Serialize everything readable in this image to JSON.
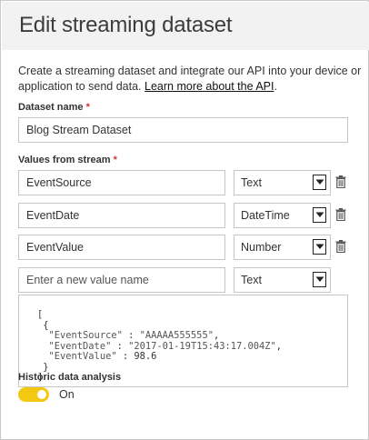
{
  "dialog": {
    "title": "Edit streaming dataset",
    "description": "Create a streaming dataset and integrate our API into your device or application to send data.",
    "learn_more_link": "Learn more about the API",
    "learn_more_suffix": "."
  },
  "dataset_name": {
    "label": "Dataset name",
    "required_marker": "*",
    "value": "Blog Stream Dataset"
  },
  "values_from_stream": {
    "label": "Values from stream",
    "required_marker": "*",
    "rows": [
      {
        "name": "EventSource",
        "type": "Text"
      },
      {
        "name": "EventDate",
        "type": "DateTime"
      },
      {
        "name": "EventValue",
        "type": "Number"
      }
    ],
    "new_row": {
      "placeholder": "Enter a new value name",
      "type": "Text"
    }
  },
  "json_sample": {
    "open_bracket": "[",
    "open_brace": "{",
    "line1_key": "\"EventSource\"",
    "line1_sep": " : ",
    "line1_val": "\"AAAAA555555\"",
    "line1_end": ",",
    "line2_key": "\"EventDate\"",
    "line2_sep": " : ",
    "line2_val": "\"2017-01-19T15:43:17.004Z\"",
    "line2_end": ",",
    "line3_key": "\"EventValue\"",
    "line3_sep": " : ",
    "line3_val": "98.6",
    "close_brace": "}",
    "close_bracket": "]"
  },
  "historic": {
    "label": "Historic data analysis",
    "toggle_state": "On",
    "toggle_color": "#f2c811"
  },
  "icons": {
    "dropdown": "chevron-down-icon",
    "delete": "trash-icon"
  }
}
